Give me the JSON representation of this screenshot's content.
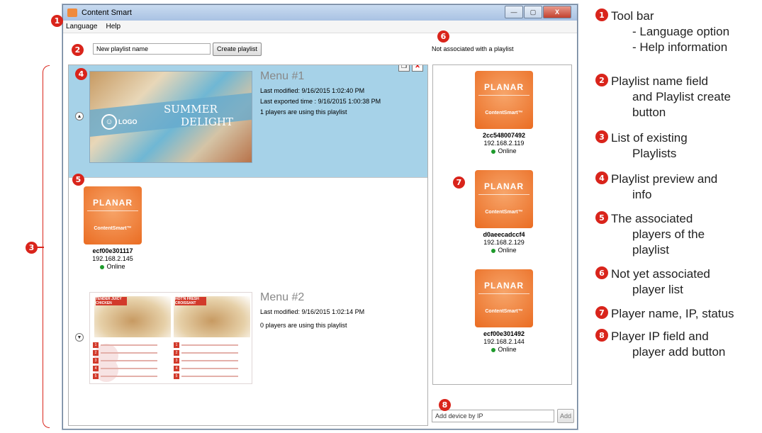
{
  "window": {
    "title": "Content Smart",
    "controls": {
      "minimize": "—",
      "maximize": "▢",
      "close": "X"
    }
  },
  "menubar": {
    "items": [
      "Language",
      "Help"
    ]
  },
  "playlist_create": {
    "name_value": "New playlist name",
    "button_label": "Create playlist"
  },
  "playlists": [
    {
      "name": "Menu #1",
      "last_modified": "Last modified: 9/16/2015 1:02:40 PM",
      "last_exported": "Last exported time : 9/16/2015 1:00:38 PM",
      "players_using": "1 players are using this playlist",
      "thumb_text": {
        "logo": "LOGO",
        "line1": "SUMMER",
        "line2": "DELIGHT"
      }
    },
    {
      "name": "Menu #2",
      "last_modified": "Last modified: 9/16/2015 1:02:14 PM",
      "players_using": "0 players are using this playlist",
      "thumb_text": {
        "tag1": "TENDER JUICY CHICKEN",
        "tag2": "HOT'N FRESH CROISSANT"
      }
    }
  ],
  "associated_players": [
    {
      "name": "ecf00e301117",
      "ip": "192.168.2.145",
      "status": "Online",
      "brand": "PLANAR",
      "product": "ContentSmart™"
    }
  ],
  "not_associated": {
    "header": "Not associated with a playlist",
    "players": [
      {
        "name": "2cc548007492",
        "ip": "192.168.2.119",
        "status": "Online",
        "brand": "PLANAR",
        "product": "ContentSmart™"
      },
      {
        "name": "d0aeecadccf4",
        "ip": "192.168.2.129",
        "status": "Online",
        "brand": "PLANAR",
        "product": "ContentSmart™"
      },
      {
        "name": "ecf00e301492",
        "ip": "192.168.2.144",
        "status": "Online",
        "brand": "PLANAR",
        "product": "ContentSmart™"
      }
    ]
  },
  "add_device": {
    "value": "Add device by IP",
    "button_label": "Add"
  },
  "callouts": [
    "1",
    "2",
    "3",
    "4",
    "5",
    "6",
    "7",
    "8"
  ],
  "legend": [
    {
      "num": "1",
      "lines": [
        "Tool bar",
        "- Language option",
        "- Help information"
      ]
    },
    {
      "num": "2",
      "lines": [
        "Playlist name field",
        "and Playlist create",
        "button"
      ]
    },
    {
      "num": "3",
      "lines": [
        "List of existing",
        "Playlists"
      ]
    },
    {
      "num": "4",
      "lines": [
        "Playlist preview and",
        "info"
      ]
    },
    {
      "num": "5",
      "lines": [
        "The associated",
        "players of the",
        "playlist"
      ]
    },
    {
      "num": "6",
      "lines": [
        "Not yet associated",
        "player list"
      ]
    },
    {
      "num": "7",
      "lines": [
        "Player name, IP, status"
      ]
    },
    {
      "num": "8",
      "lines": [
        "Player IP field and",
        "player add button"
      ]
    }
  ],
  "colors": {
    "accent": "#d9241b",
    "selection": "#a6d2e8",
    "tile": "#ea6c22",
    "online": "#1e9a2c"
  }
}
